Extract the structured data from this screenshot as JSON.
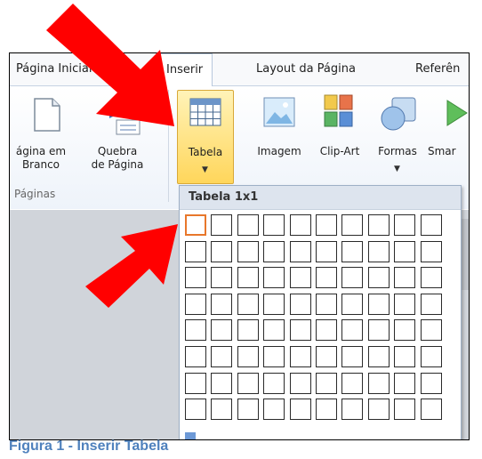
{
  "tabs": [
    "Página Inicial",
    "Inserir",
    "Layout da Página",
    "Referên"
  ],
  "ribbon": {
    "blank_page_l1": "ágina em",
    "blank_page_l2": "Branco",
    "page_break_l1": "Quebra",
    "page_break_l2": "de Página",
    "group_pages": "Páginas",
    "table": "Tabela",
    "picture": "Imagem",
    "clip_art": "Clip-Art",
    "shapes": "Formas",
    "smartart": "Smar"
  },
  "dropdown": {
    "title": "Tabela 1x1",
    "grid_columns": 10,
    "grid_rows": 8,
    "selected_columns": 1,
    "selected_rows": 1
  },
  "caption": "Figura 1 - Inserir Tabela",
  "colors": {
    "arrow": "#ff0000",
    "caption": "#4f81bd",
    "highlight": "#ffd65b",
    "selected_cell_border": "#e8772b"
  }
}
